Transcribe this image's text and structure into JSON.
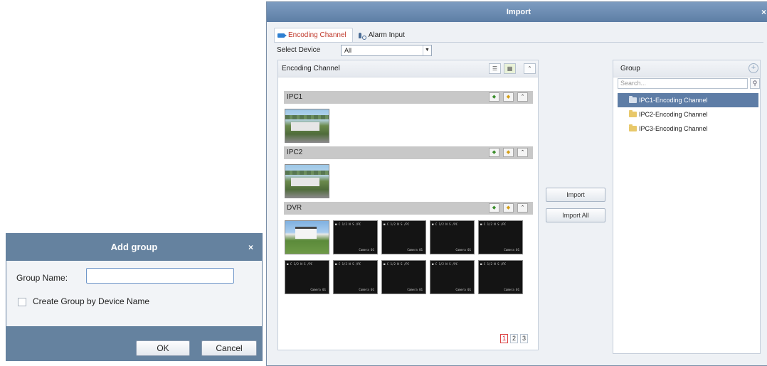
{
  "import_window": {
    "title": "Import",
    "close": "×",
    "tabs": [
      {
        "label": "Encoding Channel",
        "icon": "camera-icon"
      },
      {
        "label": "Alarm Input",
        "icon": "alarm-icon"
      }
    ],
    "select_device": {
      "label": "Select Device",
      "value": "All"
    },
    "encoding_panel": {
      "title": "Encoding Channel",
      "devices": [
        {
          "name": "IPC1"
        },
        {
          "name": "IPC2"
        },
        {
          "name": "DVR"
        }
      ],
      "osd_text": "■ C 1/2 N S /PC",
      "osd_cam": "Camera 01",
      "pages": [
        "1",
        "2",
        "3"
      ],
      "current_page": "1"
    },
    "buttons": {
      "import": "Import",
      "import_all": "Import All"
    },
    "group_panel": {
      "title": "Group",
      "search_placeholder": "Search...",
      "items": [
        {
          "label": "IPC1-Encoding Channel",
          "selected": true
        },
        {
          "label": "IPC2-Encoding Channel",
          "selected": false
        },
        {
          "label": "IPC3-Encoding Channel",
          "selected": false
        }
      ]
    }
  },
  "add_group_dialog": {
    "title": "Add group",
    "close": "×",
    "group_name_label": "Group Name:",
    "group_name_value": "",
    "create_by_device_label": "Create Group by Device Name",
    "create_by_device_checked": false,
    "ok": "OK",
    "cancel": "Cancel"
  },
  "colors": {
    "title_bar": "#65829f",
    "selected_group": "#5e7da6",
    "active_tab_text": "#c0392b"
  }
}
